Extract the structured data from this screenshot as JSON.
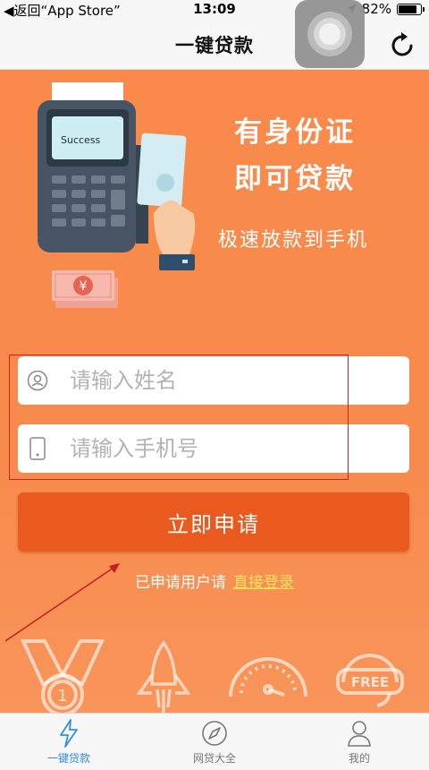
{
  "status_bar": {
    "back_label": "◀返回“App Store”",
    "time": "13:09",
    "battery": "82%",
    "battery_level": 0.82
  },
  "nav": {
    "title": "一键贷款"
  },
  "hero": {
    "slogan_line1": "有身份证",
    "slogan_line2": "即可贷款",
    "slogan_line3": "极速放款到手机",
    "pos_screen_text": "Success",
    "money_symbol": "¥"
  },
  "form": {
    "name_placeholder": "请输入姓名",
    "phone_placeholder": "请输入手机号",
    "apply_label": "立即申请",
    "login_prompt": "已申请用户请",
    "login_link": "直接登录"
  },
  "features": {
    "medal_number": "1",
    "free_label": "FREE"
  },
  "tabs": [
    {
      "label": "一键贷款",
      "icon": "lightning-icon",
      "active": true
    },
    {
      "label": "网贷大全",
      "icon": "compass-icon",
      "active": false
    },
    {
      "label": "我的",
      "icon": "person-icon",
      "active": false
    }
  ],
  "colors": {
    "background_orange": "#f98a4c",
    "button_orange": "#ea5a1e",
    "link_yellow": "#ffe45b",
    "tab_active": "#2f8fe0",
    "annotation_red": "#d62020"
  }
}
